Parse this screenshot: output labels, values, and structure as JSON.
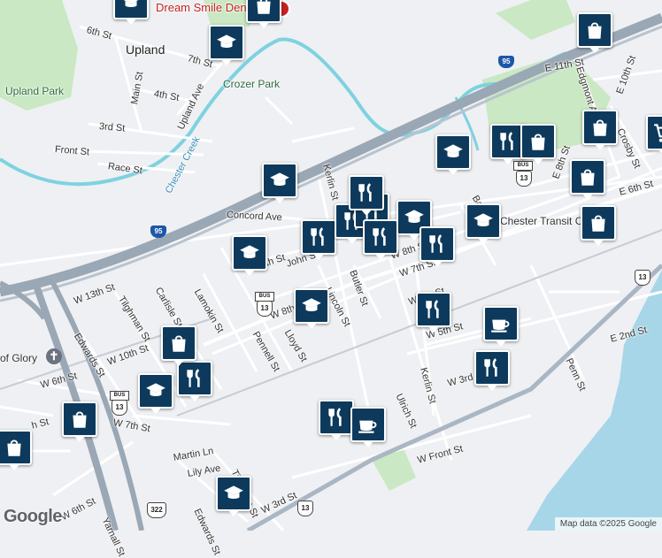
{
  "map": {
    "colors": {
      "land": "#eef0f3",
      "park": "#c9e8c3",
      "water": "#a7d6e8",
      "river": "#7ed2e0",
      "highway": "#9aa7b5",
      "road": "#ffffff",
      "marker": "#0d3a5c"
    },
    "towns": [
      {
        "label": "Upland"
      }
    ],
    "parks": [
      {
        "label": "Upland Park"
      },
      {
        "label": "Crozer Park"
      }
    ],
    "waterways": [
      {
        "label": "Chester Creek"
      }
    ],
    "places": [
      {
        "label": "Dream Smile Dent",
        "icon": "dentist-icon"
      },
      {
        "label": "Chester Transit Cen",
        "icon": "transit-icon"
      },
      {
        "label": "of Glory",
        "icon": "church-icon"
      }
    ],
    "streets": [
      {
        "label": "6th St"
      },
      {
        "label": "7th St"
      },
      {
        "label": "Main St"
      },
      {
        "label": "4th St"
      },
      {
        "label": "3rd St"
      },
      {
        "label": "Front St"
      },
      {
        "label": "Race St"
      },
      {
        "label": "Upland Ave"
      },
      {
        "label": "Concord Ave"
      },
      {
        "label": "Kerlin St"
      },
      {
        "label": "John St"
      },
      {
        "label": "W 10th St"
      },
      {
        "label": "Lamokin St"
      },
      {
        "label": "Carlisle St"
      },
      {
        "label": "Tilghman St"
      },
      {
        "label": "W 13th St"
      },
      {
        "label": "Edwards St"
      },
      {
        "label": "W 10th St"
      },
      {
        "label": "W 8th St"
      },
      {
        "label": "Lloyd St"
      },
      {
        "label": "Pennell St"
      },
      {
        "label": "Lincoln St"
      },
      {
        "label": "Butler St"
      },
      {
        "label": "W 7th St"
      },
      {
        "label": "W 8th St"
      },
      {
        "label": "W 7th St"
      },
      {
        "label": "W 5th St"
      },
      {
        "label": "W 3rd St"
      },
      {
        "label": "Ulrich St"
      },
      {
        "label": "Kerlin St"
      },
      {
        "label": "W Front St"
      },
      {
        "label": "Martin Ln"
      },
      {
        "label": "Lily Ave"
      },
      {
        "label": "W 3rd St"
      },
      {
        "label": "W 6th St"
      },
      {
        "label": "E 2nd St"
      },
      {
        "label": "Penn St"
      },
      {
        "label": "E 6th St"
      },
      {
        "label": "E 8th St"
      },
      {
        "label": "E 10th St"
      },
      {
        "label": "E 11th St"
      },
      {
        "label": "Edgmont Ave"
      },
      {
        "label": "Crosby St"
      },
      {
        "label": "Barclay St"
      },
      {
        "label": "Tilghman St"
      },
      {
        "label": "Edwards St"
      },
      {
        "label": "W 7th St"
      },
      {
        "label": "h St"
      },
      {
        "label": "Yarnall St"
      },
      {
        "label": "W 6th St"
      }
    ],
    "shields": [
      {
        "label": "95",
        "kind": "interstate"
      },
      {
        "label": "95",
        "kind": "interstate"
      },
      {
        "label": "13",
        "kind": "us"
      },
      {
        "label": "13",
        "kind": "us"
      },
      {
        "label": "13",
        "kind": "us"
      },
      {
        "label": "13",
        "kind": "us"
      },
      {
        "label": "13",
        "kind": "us"
      },
      {
        "label": "322",
        "kind": "us"
      },
      {
        "label": "BUS",
        "kind": "business"
      },
      {
        "label": "BUS",
        "kind": "business"
      },
      {
        "label": "BUS",
        "kind": "business"
      }
    ],
    "markers": [
      {
        "icon": "school-icon",
        "category": "school"
      },
      {
        "icon": "school-icon",
        "category": "school"
      },
      {
        "icon": "school-icon",
        "category": "school"
      },
      {
        "icon": "school-icon",
        "category": "school"
      },
      {
        "icon": "school-icon",
        "category": "school"
      },
      {
        "icon": "school-icon",
        "category": "school"
      },
      {
        "icon": "school-icon",
        "category": "school"
      },
      {
        "icon": "school-icon",
        "category": "school"
      },
      {
        "icon": "school-icon",
        "category": "school"
      },
      {
        "icon": "school-icon",
        "category": "school"
      },
      {
        "icon": "restaurant-icon",
        "category": "restaurant"
      },
      {
        "icon": "restaurant-icon",
        "category": "restaurant"
      },
      {
        "icon": "restaurant-icon",
        "category": "restaurant"
      },
      {
        "icon": "restaurant-icon",
        "category": "restaurant"
      },
      {
        "icon": "restaurant-icon",
        "category": "restaurant"
      },
      {
        "icon": "restaurant-icon",
        "category": "restaurant"
      },
      {
        "icon": "restaurant-icon",
        "category": "restaurant"
      },
      {
        "icon": "restaurant-icon",
        "category": "restaurant"
      },
      {
        "icon": "restaurant-icon",
        "category": "restaurant"
      },
      {
        "icon": "restaurant-icon",
        "category": "restaurant"
      },
      {
        "icon": "restaurant-icon",
        "category": "restaurant"
      },
      {
        "icon": "shopping-bag-icon",
        "category": "shopping"
      },
      {
        "icon": "shopping-bag-icon",
        "category": "shopping"
      },
      {
        "icon": "shopping-bag-icon",
        "category": "shopping"
      },
      {
        "icon": "shopping-bag-icon",
        "category": "shopping"
      },
      {
        "icon": "shopping-bag-icon",
        "category": "shopping"
      },
      {
        "icon": "shopping-bag-icon",
        "category": "shopping"
      },
      {
        "icon": "shopping-bag-icon",
        "category": "shopping"
      },
      {
        "icon": "shopping-bag-icon",
        "category": "shopping"
      },
      {
        "icon": "shopping-bag-icon",
        "category": "shopping"
      },
      {
        "icon": "coffee-icon",
        "category": "cafe"
      },
      {
        "icon": "coffee-icon",
        "category": "cafe"
      },
      {
        "icon": "shopping-cart-icon",
        "category": "grocery"
      }
    ],
    "branding": {
      "logo": "Google",
      "attribution": "Map data ©2025 Google"
    }
  }
}
